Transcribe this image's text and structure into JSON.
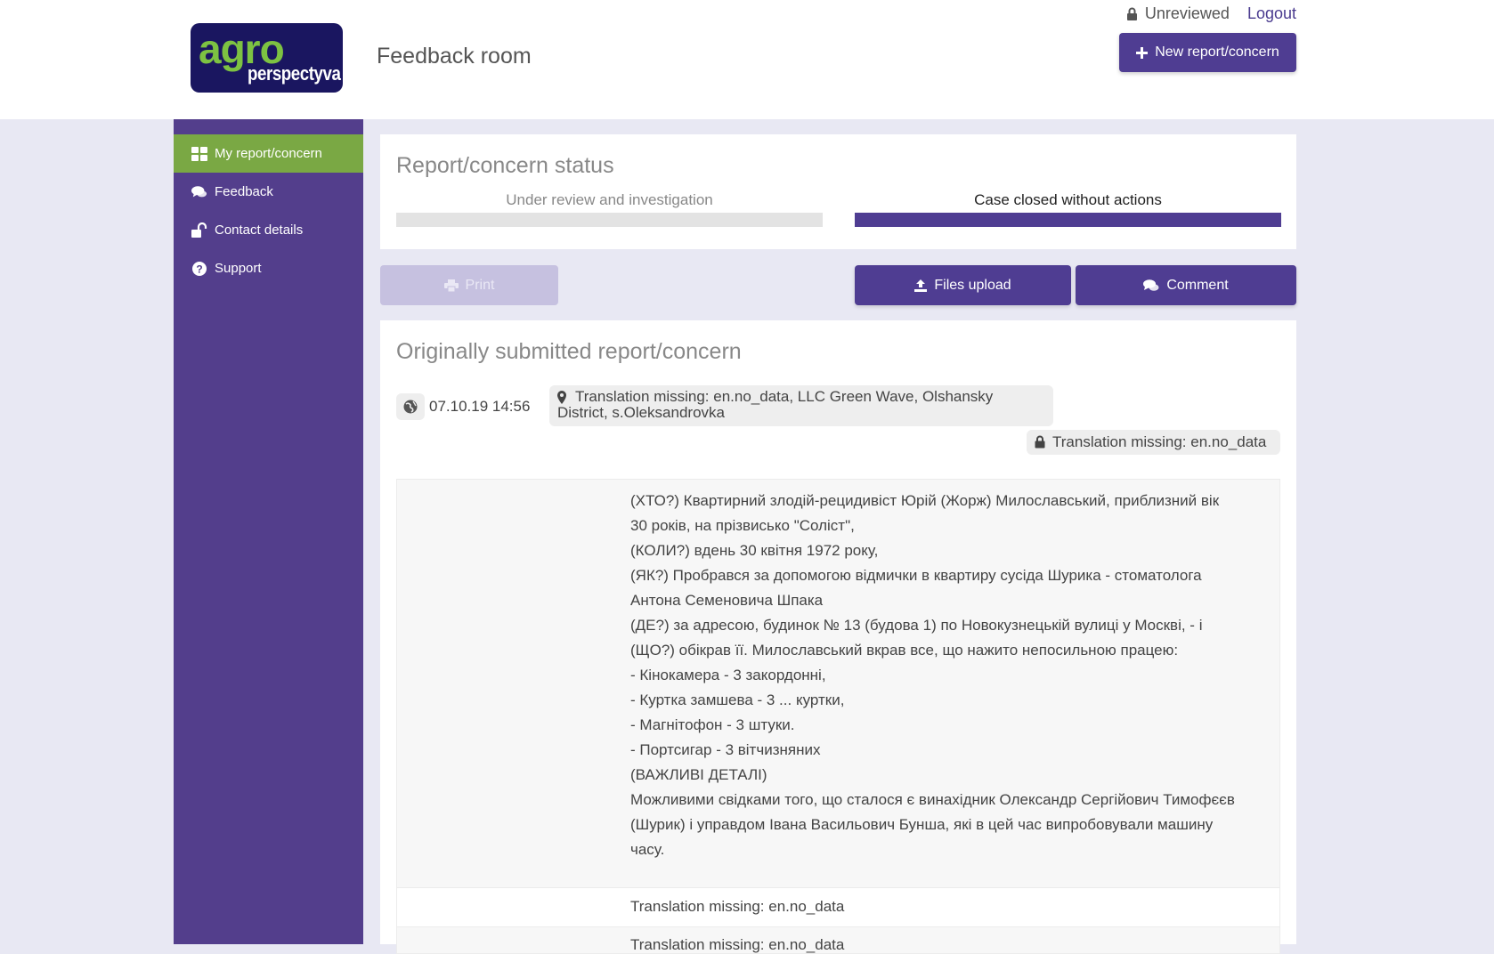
{
  "header": {
    "logo_line1": "agro",
    "logo_line2": "perspectyva",
    "title": "Feedback room",
    "unreviewed": "Unreviewed",
    "logout": "Logout",
    "new_report_button": "New report/concern"
  },
  "sidebar": {
    "items": [
      {
        "label": "My report/concern",
        "icon": "dashboard-icon",
        "active": true
      },
      {
        "label": "Feedback",
        "icon": "comments-icon",
        "active": false
      },
      {
        "label": "Contact details",
        "icon": "unlock-icon",
        "active": false
      },
      {
        "label": "Support",
        "icon": "question-circle-icon",
        "active": false
      }
    ]
  },
  "status": {
    "title": "Report/concern status",
    "stages": [
      {
        "label": "Under review and investigation",
        "active": false
      },
      {
        "label": "Case closed without actions",
        "active": true
      }
    ]
  },
  "actions": {
    "print": "Print",
    "files_upload": "Files upload",
    "comment": "Comment"
  },
  "report": {
    "title": "Originally submitted report/concern",
    "date": "07.10.19 14:56",
    "location_line1": "Translation missing: en.no_data, LLC Green Wave, Olshansky",
    "location_line2": "District, s.Oleksandrovka",
    "privacy": "Translation missing: en.no_data",
    "body_lines": [
      "(ХТО?) Квартирний злодій-рецидивіст Юрій (Жорж) Милославський, приблизний вік",
      "30 років, на прізвисько \"Соліст\",",
      "(КОЛИ?) вдень 30 квітня 1972 року,",
      "(ЯК?) Пробрався за допомогою відмички в квартиру сусіда Шурика - стоматолога",
      "Антона Семеновича Шпака",
      "(ДЕ?) за адресою, будинок № 13 (будова 1) по Новокузнецькій вулиці у Москві, - і",
      "(ЩО?) обікрав її. Милославський вкрав все, що нажито непосильною працею:",
      "- Кінокамера - 3 закордонні,",
      "- Куртка замшева - 3 ... куртки,",
      "- Магнітофон - 3 штуки.",
      "- Портсигар - 3 вітчизняних",
      "(ВАЖЛИВІ ДЕТАЛІ)",
      "Можливими свідками того, що сталося є винахідник Олександр Сергійович Тимофєєв",
      "(Шурик) і управдом Івана Васильович Бунша, які в цей час випробовували машину",
      "часу."
    ],
    "row2": "Translation missing: en.no_data",
    "row3": "Translation missing: en.no_data"
  },
  "colors": {
    "primary": "#4f3d92",
    "sidebar": "#533e8c",
    "active_nav": "#7aa844",
    "page_bg": "#e8e8f3"
  }
}
